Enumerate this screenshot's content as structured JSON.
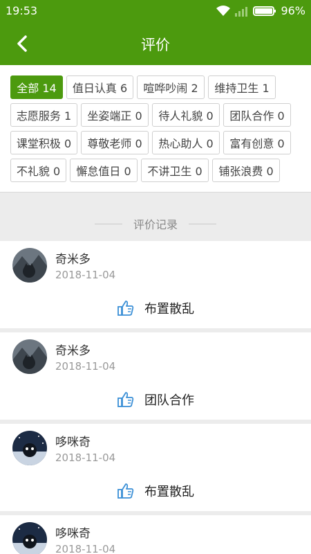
{
  "status_bar": {
    "time": "19:53",
    "battery": "96%",
    "icons": [
      "wifi-icon",
      "signal-icon",
      "battery-icon"
    ]
  },
  "header": {
    "title": "评价",
    "back_icon": "chevron-left-icon"
  },
  "colors": {
    "brand": "#4c9a0e",
    "thumb": "#3a8fd6"
  },
  "filters": [
    {
      "label": "全部 14",
      "active": true
    },
    {
      "label": "值日认真 6"
    },
    {
      "label": "喧哗吵闹 2"
    },
    {
      "label": "维持卫生 1"
    },
    {
      "label": "志愿服务 1"
    },
    {
      "label": "坐姿端正 0"
    },
    {
      "label": "待人礼貌 0"
    },
    {
      "label": "团队合作 0"
    },
    {
      "label": "课堂积极 0"
    },
    {
      "label": "尊敬老师 0"
    },
    {
      "label": "热心助人 0"
    },
    {
      "label": "富有创意 0"
    },
    {
      "label": "不礼貌 0"
    },
    {
      "label": "懈怠值日 0"
    },
    {
      "label": "不讲卫生 0"
    },
    {
      "label": "铺张浪费 0"
    }
  ],
  "records_title": "评价记录",
  "records": [
    {
      "name": "奇米多",
      "date": "2018-11-04",
      "evaluation": "布置散乱",
      "icon": "thumbs-up-icon"
    },
    {
      "name": "奇米多",
      "date": "2018-11-04",
      "evaluation": "团队合作",
      "icon": "thumbs-up-icon"
    },
    {
      "name": "哆咪奇",
      "date": "2018-11-04",
      "evaluation": "布置散乱",
      "icon": "thumbs-up-icon"
    },
    {
      "name": "哆咪奇",
      "date": "2018-11-04",
      "evaluation": ""
    }
  ]
}
